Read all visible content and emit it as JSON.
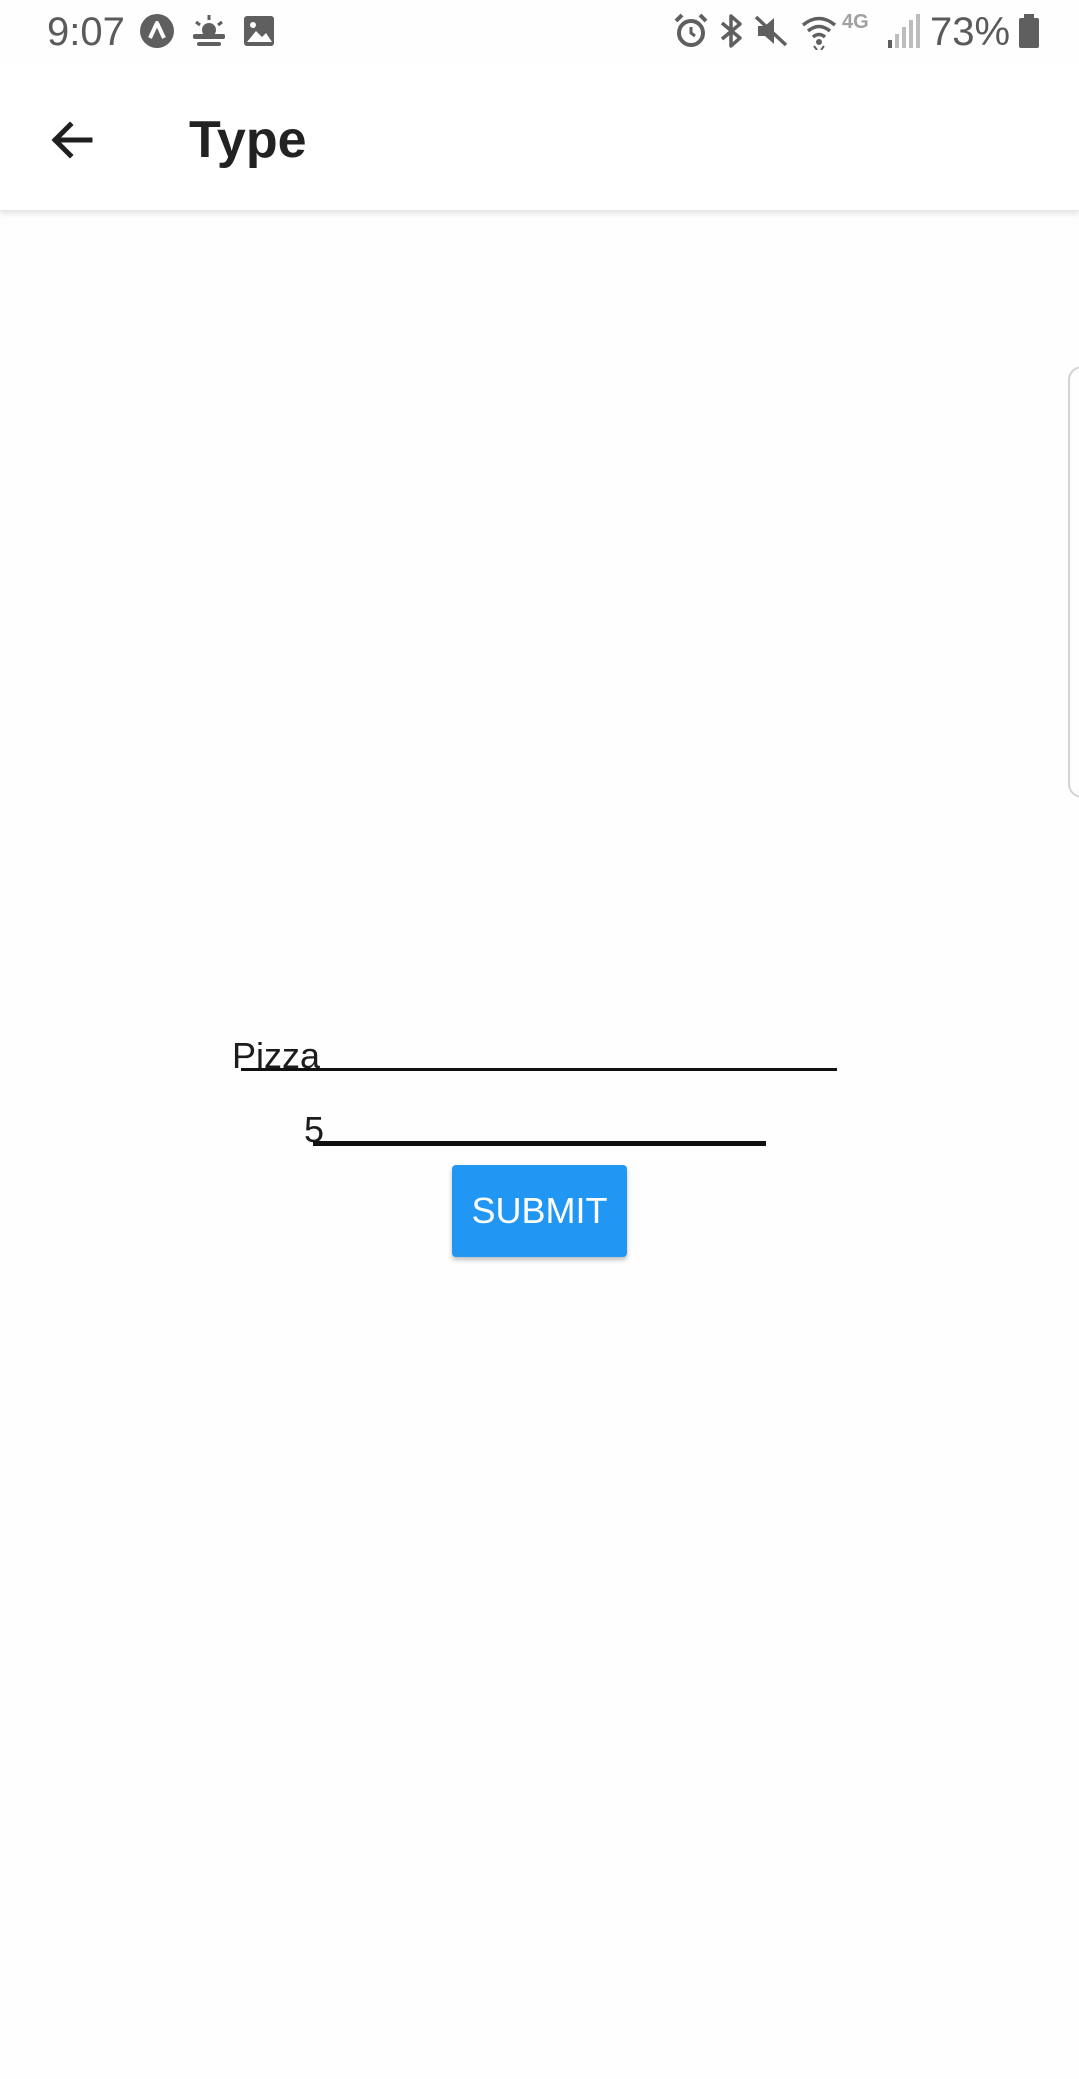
{
  "status_bar": {
    "time": "9:07",
    "battery_percent": "73%",
    "left_icons": [
      "app-notification-icon",
      "weather-icon",
      "image-icon"
    ],
    "right_icons": [
      "alarm-icon",
      "bluetooth-icon",
      "mute-icon",
      "wifi-icon",
      "lte-icon",
      "signal-icon",
      "battery-icon"
    ],
    "network_label": "4G"
  },
  "app_bar": {
    "title": "Type",
    "back_icon": "arrow-back-icon"
  },
  "form": {
    "type_field": {
      "value": "Pizza"
    },
    "quantity_field": {
      "value": "5"
    },
    "submit_label": "SUBMIT"
  },
  "colors": {
    "accent": "#2196f3",
    "background": "#fefefe"
  }
}
